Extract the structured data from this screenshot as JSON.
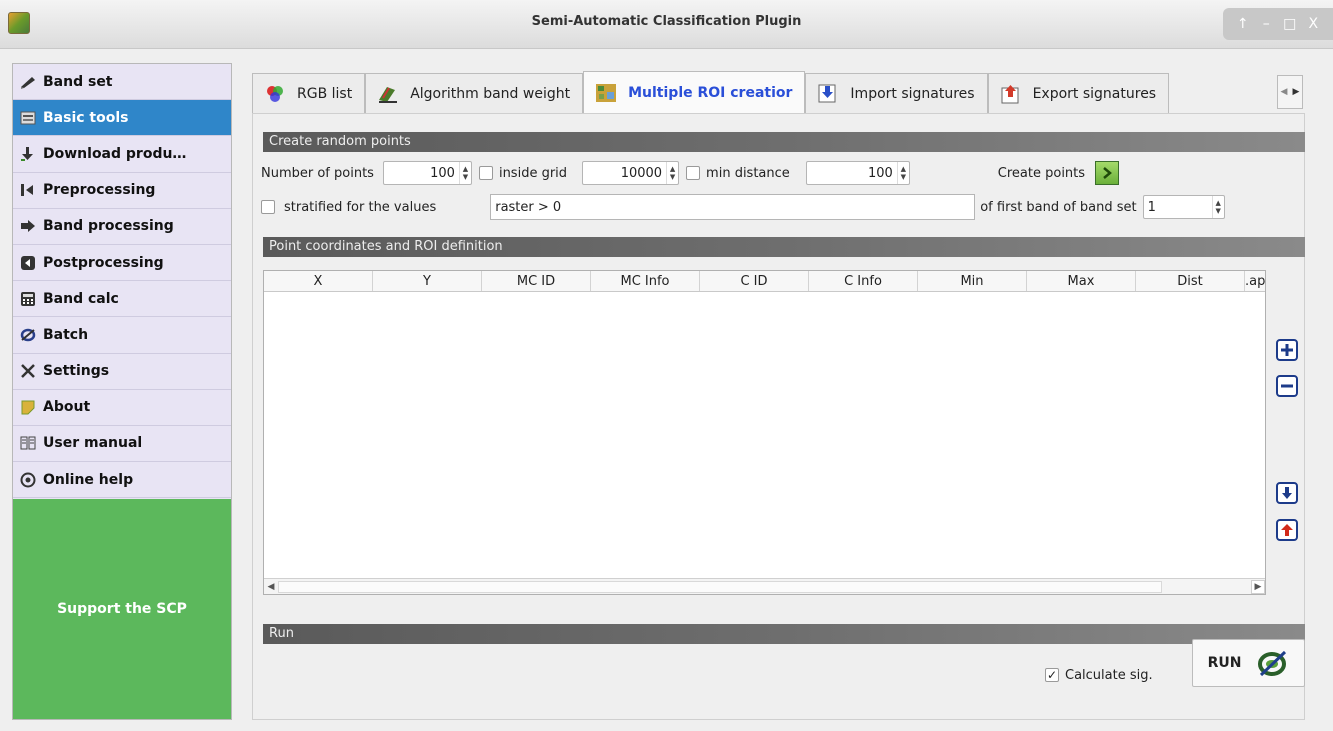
{
  "window": {
    "title": "Semi-Automatic Classification Plugin",
    "controls": [
      "↑",
      "–",
      "□",
      "X"
    ]
  },
  "sidebar": {
    "items": [
      {
        "label": "Band set",
        "icon": "pen-icon"
      },
      {
        "label": "Basic tools",
        "icon": "tools-icon",
        "active": true
      },
      {
        "label": "Download produ…",
        "icon": "download-icon"
      },
      {
        "label": "Preprocessing",
        "icon": "preprocessing-icon"
      },
      {
        "label": "Band processing",
        "icon": "band-processing-icon"
      },
      {
        "label": "Postprocessing",
        "icon": "postprocessing-icon"
      },
      {
        "label": "Band calc",
        "icon": "calculator-icon"
      },
      {
        "label": "Batch",
        "icon": "batch-icon"
      },
      {
        "label": "Settings",
        "icon": "settings-icon"
      },
      {
        "label": "About",
        "icon": "about-icon"
      },
      {
        "label": "User manual",
        "icon": "manual-icon"
      },
      {
        "label": "Online help",
        "icon": "help-icon"
      }
    ],
    "support_label": "Support the SCP"
  },
  "tabs": [
    {
      "label": "RGB list",
      "icon": "rgb-icon"
    },
    {
      "label": "Algorithm band weight",
      "icon": "weight-icon"
    },
    {
      "label": "Multiple ROI creatior",
      "icon": "multiple-roi-icon",
      "active": true
    },
    {
      "label": "Import signatures",
      "icon": "import-icon"
    },
    {
      "label": "Export signatures",
      "icon": "export-icon"
    }
  ],
  "random_points": {
    "section_title": "Create random points",
    "number_of_points_label": "Number of points",
    "number_of_points_value": "100",
    "inside_grid_label": "inside grid",
    "inside_grid_value": "10000",
    "min_distance_label": "min distance",
    "min_distance_value": "100",
    "create_points_label": "Create points",
    "stratified_label": "stratified for the values",
    "stratified_expression": "raster > 0",
    "first_band_label": "of first band of band set",
    "first_band_value": "1"
  },
  "roi_definition": {
    "section_title": "Point coordinates and ROI definition",
    "columns": [
      "X",
      "Y",
      "MC ID",
      "MC Info",
      "C ID",
      "C Info",
      "Min",
      "Max",
      "Dist",
      ".ap"
    ]
  },
  "run": {
    "section_title": "Run",
    "calculate_sig_label": "Calculate sig.",
    "calculate_sig_checked": true,
    "run_label": "RUN"
  }
}
